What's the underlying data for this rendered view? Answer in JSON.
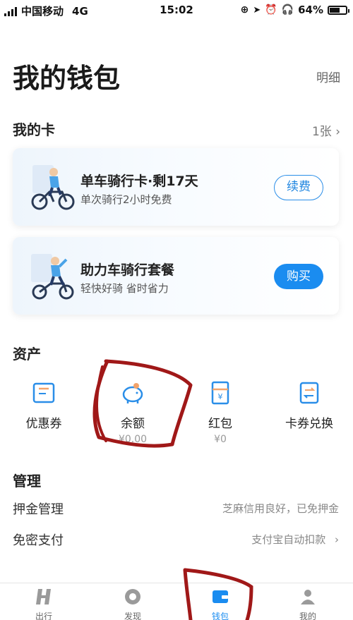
{
  "status_bar": {
    "carrier": "中国移动",
    "network": "4G",
    "time": "15:02",
    "battery": "64%",
    "battery_level": 0.64
  },
  "header": {
    "title": "我的钱包",
    "detail_link": "明细"
  },
  "cards_section": {
    "title": "我的卡",
    "count": "1张",
    "cards": [
      {
        "title": "单车骑行卡·剩17天",
        "subtitle": "单次骑行2小时免费",
        "button": "续费"
      },
      {
        "title": "助力车骑行套餐",
        "subtitle": "轻快好骑 省时省力",
        "button": "购买"
      }
    ]
  },
  "assets_section": {
    "title": "资产",
    "items": [
      {
        "label": "优惠券",
        "value": "",
        "icon": "coupon-icon"
      },
      {
        "label": "余额",
        "value": "¥0.00",
        "icon": "piggy-bank-icon"
      },
      {
        "label": "红包",
        "value": "¥0",
        "icon": "red-envelope-icon"
      },
      {
        "label": "卡券兑换",
        "value": "",
        "icon": "exchange-icon"
      }
    ]
  },
  "manage_section": {
    "title": "管理",
    "rows": [
      {
        "label": "押金管理",
        "value": "芝麻信用良好，已免押金"
      },
      {
        "label": "免密支付",
        "value": "支付宝自动扣款"
      }
    ]
  },
  "tab_bar": {
    "tabs": [
      {
        "label": "出行",
        "icon": "ride-icon"
      },
      {
        "label": "发现",
        "icon": "discover-icon"
      },
      {
        "label": "钱包",
        "icon": "wallet-icon",
        "active": true
      },
      {
        "label": "我的",
        "icon": "profile-icon"
      }
    ]
  },
  "colors": {
    "accent": "#1a8cf0",
    "annotation": "#a01818"
  }
}
